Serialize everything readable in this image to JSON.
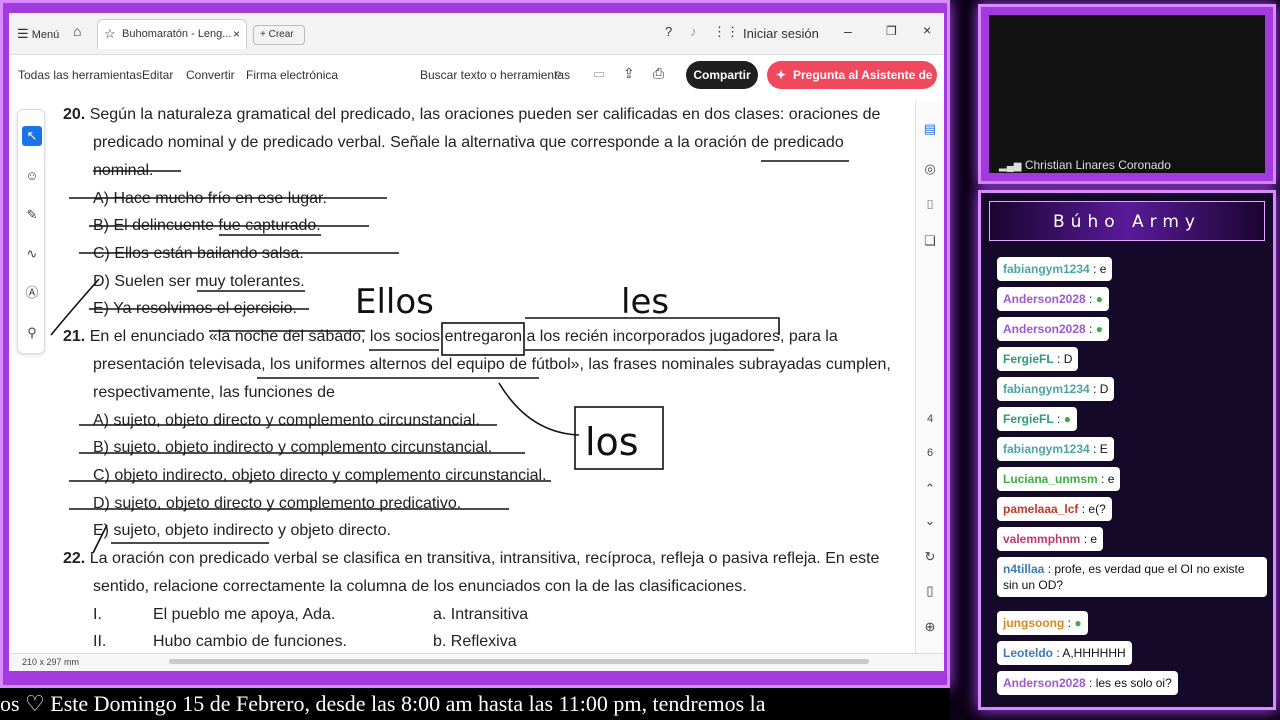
{
  "titlebar": {
    "menu": "Menú",
    "tab_title": "Buhomaratón - Leng...",
    "new_tab": "Crear",
    "signin": "Iniciar sesión"
  },
  "toolbar": {
    "tools": "Todas las herramientas",
    "edit": "Editar",
    "convert": "Convertir",
    "sign": "Firma electrónica",
    "search": "Buscar texto o herramientas",
    "share": "Compartir",
    "ai": "Pregunta al Asistente de IA"
  },
  "document": {
    "q20": {
      "num": "20.",
      "l1": "Según la naturaleza gramatical del predicado, las oraciones pueden ser calificadas en dos clases: oraciones de",
      "l2": "predicado nominal y de predicado verbal. Señale la alternativa que corresponde a la oración de predicado",
      "l3": "nominal.",
      "options": [
        "A)   Hace mucho frío en ese lugar.",
        "B)   El delincuente fue capturado.",
        "C)   Ellos están bailando salsa.",
        "D)   Suelen ser muy tolerantes.",
        "E)   Ya resolvimos el ejercicio."
      ]
    },
    "q21": {
      "num": "21.",
      "l1": "En el enunciado «la noche del sábado, los socios entregaron a los recién incorporados jugadores, para la",
      "l2": "presentación televisada, los uniformes alternos del equipo de fútbol», las frases nominales subrayadas cumplen,",
      "l3": "respectivamente, las funciones de",
      "options": [
        "A) sujeto, objeto directo y complemento circunstancial.",
        "B) sujeto, objeto indirecto y complemento circunstancial.",
        "C) objeto indirecto, objeto directo y complemento circunstancial.",
        "D) sujeto, objeto directo y complemento predicativo.",
        "E) sujeto, objeto indirecto y objeto directo."
      ]
    },
    "q22": {
      "num": "22.",
      "l1": "La oración con predicado verbal se clasifica en transitiva, intransitiva, recíproca, refleja o pasiva refleja. En este",
      "l2": "sentido, relacione correctamente la columna de los enunciados con la de las clasificaciones.",
      "rows": [
        {
          "n": "I.",
          "s": "El pueblo me apoya, Ada.",
          "c": "a. Intransitiva"
        },
        {
          "n": "II.",
          "s": "Hubo cambio de funciones.",
          "c": "b. Reflexiva"
        }
      ]
    },
    "annotations": {
      "ellos": "Ellos",
      "les": "les",
      "los": "los"
    },
    "page_size": "210 x 297 mm",
    "pages": [
      "4",
      "6"
    ]
  },
  "camera": {
    "name": "Christian Linares Coronado"
  },
  "chat": {
    "title": "Búho Army",
    "messages": [
      {
        "user": "fabiangym1234",
        "text": "e",
        "color": "#4fa3a3"
      },
      {
        "user": "Anderson2028",
        "text": "",
        "color": "#9b59d0"
      },
      {
        "user": "Anderson2028",
        "text": "",
        "color": "#9b59d0"
      },
      {
        "user": "FergieFL",
        "text": "D",
        "color": "#2e9a7a"
      },
      {
        "user": "fabiangym1234",
        "text": "D",
        "color": "#4fa3a3"
      },
      {
        "user": "FergieFL",
        "text": "",
        "color": "#2e9a7a"
      },
      {
        "user": "fabiangym1234",
        "text": "E",
        "color": "#4fa3a3"
      },
      {
        "user": "Luciana_unmsm",
        "text": "e",
        "color": "#3fae3f"
      },
      {
        "user": "pamelaaa_lcf",
        "text": "e(?",
        "color": "#c0392b"
      },
      {
        "user": "valemmphnm",
        "text": "e",
        "color": "#c0396e"
      },
      {
        "user": "n4tillaa",
        "text": "profe, es verdad que el OI no existe sin un OD?",
        "color": "#3a7bb8"
      },
      {
        "user": "jungsoong",
        "text": "",
        "color": "#d4891a"
      },
      {
        "user": "Leoteldo",
        "text": "A,HHHHHH",
        "color": "#3a7bb8"
      },
      {
        "user": "Anderson2028",
        "text": "les es solo oi?",
        "color": "#9b59d0"
      }
    ]
  },
  "ticker": "os ♡        Este Domingo 15 de Febrero, desde las 8:00 am hasta las 11:00 pm, tendremos la"
}
